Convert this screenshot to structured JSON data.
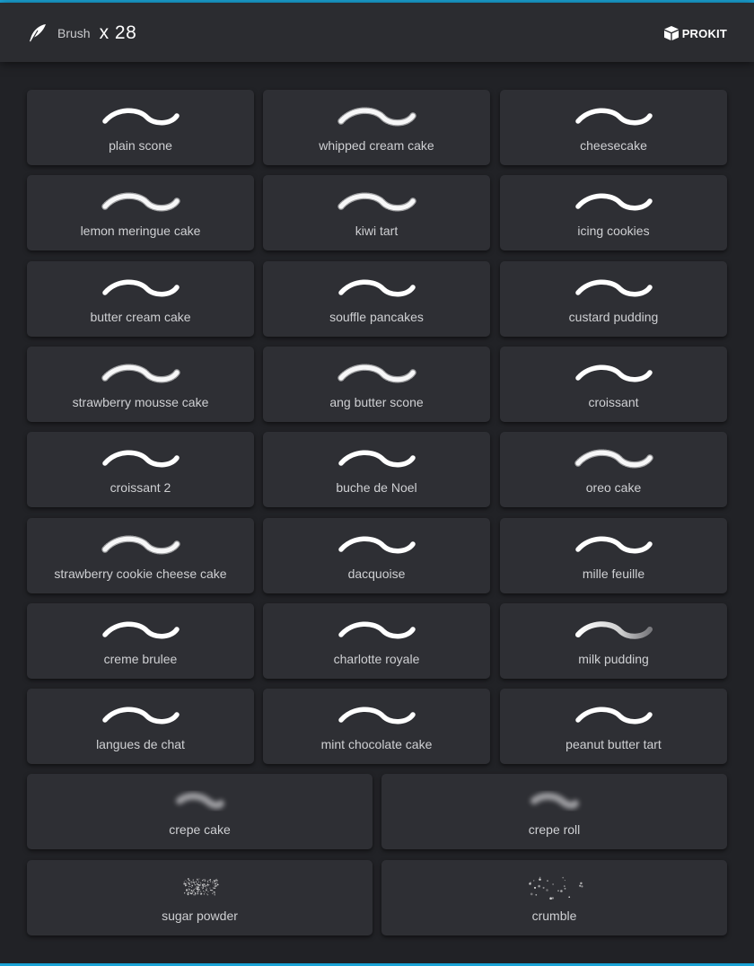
{
  "header": {
    "icon": "feather-brush-icon",
    "label": "Brush",
    "count": "x 28",
    "logo_text": "PROKIT"
  },
  "colors": {
    "accent": "#1aa3d6",
    "background": "#212226",
    "header": "#2b2c30",
    "card": "#2e2f34",
    "label": "#cfd0d3"
  },
  "brushes": [
    {
      "label": "plain scone",
      "style": "solid"
    },
    {
      "label": "whipped cream cake",
      "style": "rough"
    },
    {
      "label": "cheesecake",
      "style": "solid"
    },
    {
      "label": "lemon meringue cake",
      "style": "rough"
    },
    {
      "label": "kiwi tart",
      "style": "rough"
    },
    {
      "label": "icing cookies",
      "style": "solid"
    },
    {
      "label": "butter cream cake",
      "style": "solid"
    },
    {
      "label": "souffle pancakes",
      "style": "solid"
    },
    {
      "label": "custard pudding",
      "style": "solid"
    },
    {
      "label": "strawberry mousse cake",
      "style": "rough"
    },
    {
      "label": "ang butter scone",
      "style": "rough"
    },
    {
      "label": "croissant",
      "style": "solid"
    },
    {
      "label": "croissant 2",
      "style": "solid"
    },
    {
      "label": "buche de Noel",
      "style": "solid"
    },
    {
      "label": "oreo cake",
      "style": "rough"
    },
    {
      "label": "strawberry cookie cheese cake",
      "style": "rough"
    },
    {
      "label": "dacquoise",
      "style": "solid"
    },
    {
      "label": "mille feuille",
      "style": "solid"
    },
    {
      "label": "creme brulee",
      "style": "solid"
    },
    {
      "label": "charlotte royale",
      "style": "solid"
    },
    {
      "label": "milk pudding",
      "style": "soft"
    },
    {
      "label": "langues de chat",
      "style": "solid"
    },
    {
      "label": "mint chocolate cake",
      "style": "solid"
    },
    {
      "label": "peanut butter tart",
      "style": "solid"
    },
    {
      "label": "crepe cake",
      "style": "blur"
    },
    {
      "label": "crepe roll",
      "style": "blur"
    },
    {
      "label": "sugar powder",
      "style": "powder"
    },
    {
      "label": "crumble",
      "style": "crumble"
    }
  ]
}
